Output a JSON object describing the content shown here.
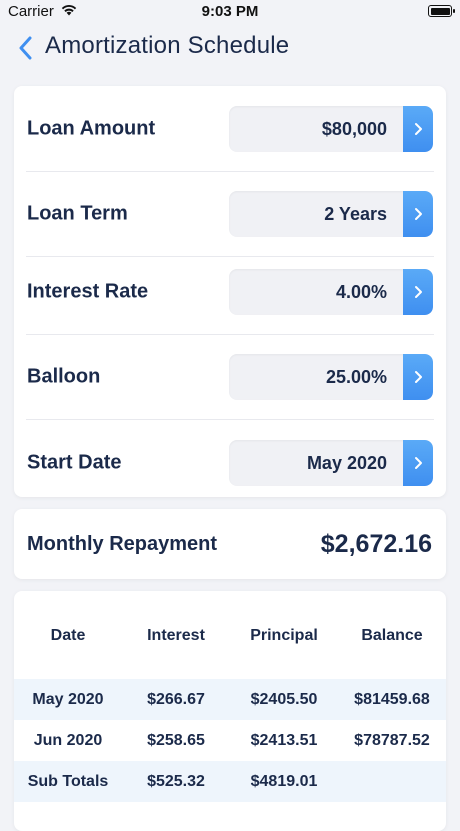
{
  "status_bar": {
    "carrier": "Carrier",
    "time": "9:03 PM",
    "battery_level": 1.0
  },
  "nav": {
    "title": "Amortization Schedule",
    "back_icon": "chevron-left-icon"
  },
  "inputs": [
    {
      "label": "Loan Amount",
      "value": "$80,000"
    },
    {
      "label": "Loan Term",
      "value": "2 Years"
    },
    {
      "label": "Interest Rate",
      "value": "4.00%"
    },
    {
      "label": "Balloon",
      "value": "25.00%"
    },
    {
      "label": "Start Date",
      "value": "May 2020"
    }
  ],
  "repayment": {
    "label": "Monthly Repayment",
    "value": "$2,672.16"
  },
  "table": {
    "headers": [
      "Date",
      "Interest",
      "Principal",
      "Balance"
    ],
    "rows": [
      [
        "May 2020",
        "$266.67",
        "$2405.50",
        "$81459.68"
      ],
      [
        "Jun 2020",
        "$258.65",
        "$2413.51",
        "$78787.52"
      ],
      [
        "Sub Totals",
        "$525.32",
        "$4819.01",
        ""
      ]
    ]
  },
  "colors": {
    "accent": "#4a9cf4",
    "text": "#1b2a4a",
    "row_shade": "#eef5fc",
    "background": "#f2f3f7"
  }
}
